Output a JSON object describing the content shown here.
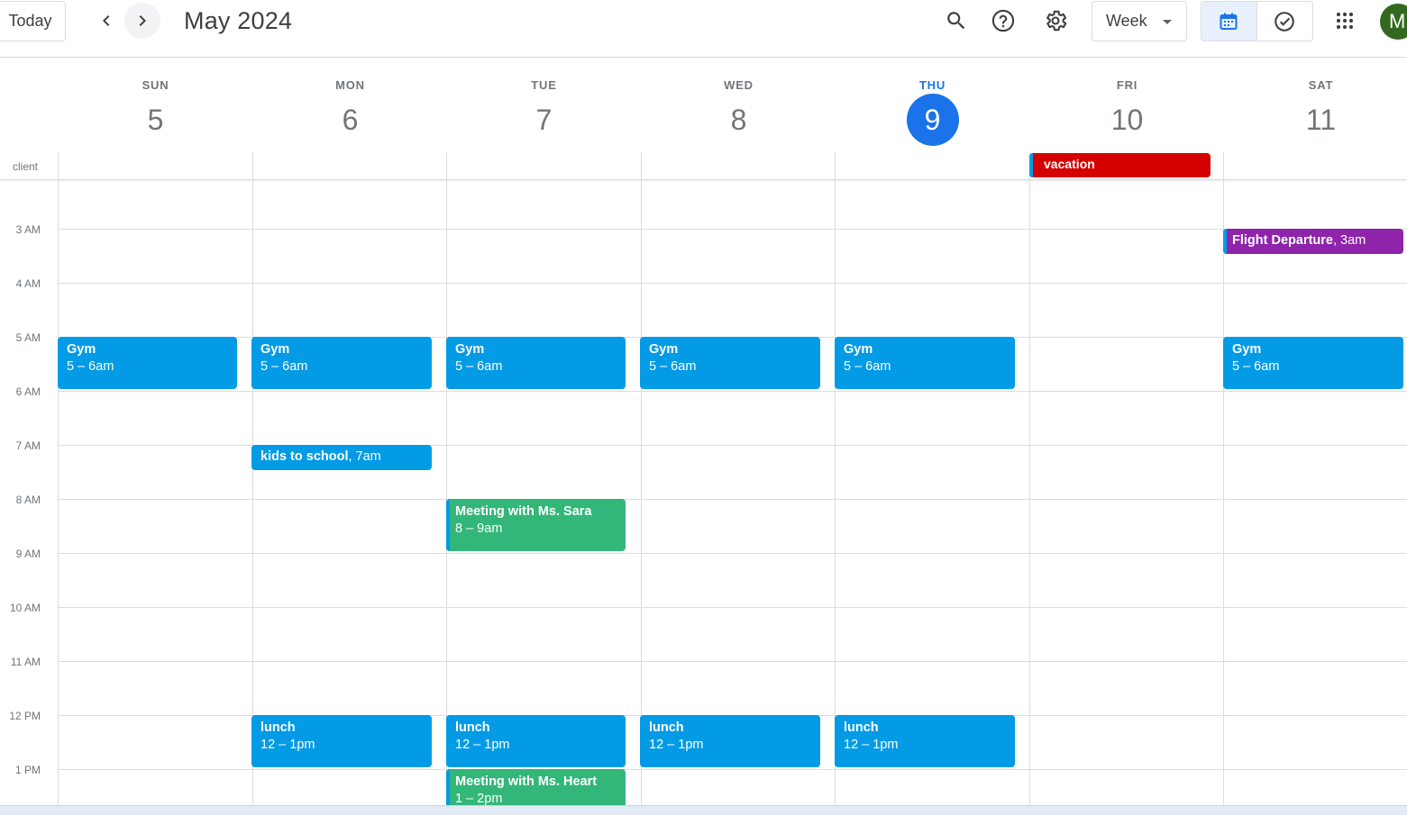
{
  "header": {
    "today_label": "Today",
    "month_title": "May 2024",
    "view_label": "Week",
    "avatar_initial": "M",
    "icons": [
      "chevron-left-icon",
      "chevron-right-icon",
      "search-icon",
      "help-icon",
      "settings-gear-icon",
      "calendar-icon",
      "tasks-check-icon",
      "apps-grid-icon"
    ]
  },
  "days": [
    {
      "dow": "SUN",
      "num": "5"
    },
    {
      "dow": "MON",
      "num": "6"
    },
    {
      "dow": "TUE",
      "num": "7"
    },
    {
      "dow": "WED",
      "num": "8"
    },
    {
      "dow": "THU",
      "num": "9",
      "today": true
    },
    {
      "dow": "FRI",
      "num": "10"
    },
    {
      "dow": "SAT",
      "num": "11"
    }
  ],
  "allday": {
    "label": "client",
    "events": [
      {
        "day": "FRI",
        "title": "vacation",
        "color": "#d50000"
      }
    ]
  },
  "time_labels": [
    "3 AM",
    "4 AM",
    "5 AM",
    "6 AM",
    "7 AM",
    "8 AM",
    "9 AM",
    "10 AM",
    "11 AM",
    "12 PM",
    "1 PM"
  ],
  "events": {
    "gym_sun": {
      "title": "Gym",
      "time": "5 – 6am"
    },
    "gym_mon": {
      "title": "Gym",
      "time": "5 – 6am"
    },
    "gym_tue": {
      "title": "Gym",
      "time": "5 – 6am"
    },
    "gym_wed": {
      "title": "Gym",
      "time": "5 – 6am"
    },
    "gym_thu": {
      "title": "Gym",
      "time": "5 – 6am"
    },
    "gym_sat": {
      "title": "Gym",
      "time": "5 – 6am"
    },
    "flight_sat": {
      "title": "Flight Departure",
      "time": ", 3am"
    },
    "kids_mon": {
      "title": "kids to school",
      "time": ", 7am"
    },
    "meeting_sara_tue": {
      "title": "Meeting with Ms. Sara",
      "time": "8 – 9am"
    },
    "lunch_mon": {
      "title": "lunch",
      "time": "12 – 1pm"
    },
    "lunch_tue": {
      "title": "lunch",
      "time": "12 – 1pm"
    },
    "lunch_wed": {
      "title": "lunch",
      "time": "12 – 1pm"
    },
    "lunch_thu": {
      "title": "lunch",
      "time": "12 – 1pm"
    },
    "meeting_heart_tue": {
      "title": "Meeting with Ms. Heart",
      "time": "1 – 2pm"
    }
  },
  "colors": {
    "blue_event": "#039be5",
    "green_event": "#33b679",
    "red_event": "#d50000",
    "purple_event": "#8e24aa",
    "today_accent": "#1a73e8"
  }
}
